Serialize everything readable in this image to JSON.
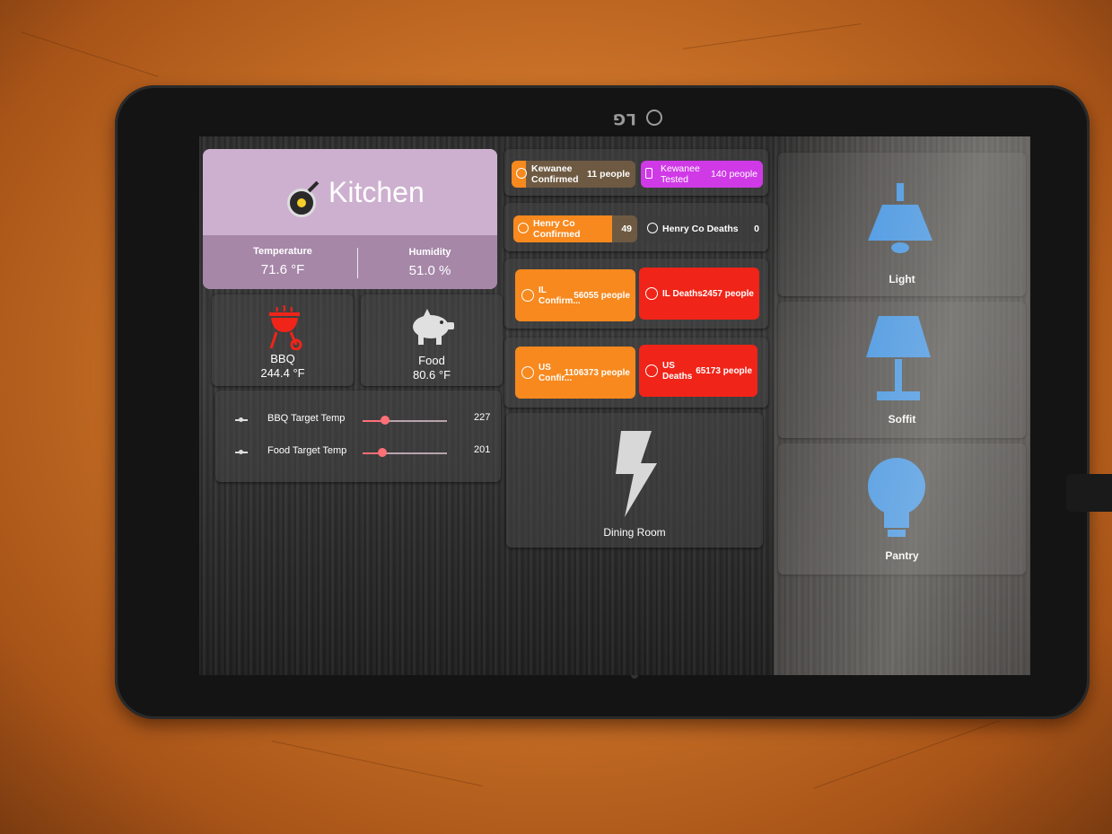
{
  "device": {
    "brand": "LG"
  },
  "kitchen": {
    "title": "Kitchen",
    "temperature_label": "Temperature",
    "temperature_value": "71.6 °F",
    "humidity_label": "Humidity",
    "humidity_value": "51.0 %"
  },
  "sensors": [
    {
      "name": "BBQ",
      "value": "244.4 °F",
      "icon": "grill-icon",
      "icon_color": "#f02418"
    },
    {
      "name": "Food",
      "value": "80.6 °F",
      "icon": "pig-icon",
      "icon_color": "#dddddd"
    }
  ],
  "sliders": [
    {
      "label": "BBQ Target Temp",
      "value": "227",
      "level": 0.27
    },
    {
      "label": "Food Target Temp",
      "value": "201",
      "level": 0.23
    }
  ],
  "stats": {
    "kewanee_confirmed": {
      "label_1": "Kewanee",
      "label_2": "Confirmed",
      "value": "11 people"
    },
    "kewanee_tested": {
      "label_1": "Kewanee",
      "label_2": "Tested",
      "value": "140 people"
    },
    "henry_confirmed": {
      "label_1": "Henry Co",
      "label_2": "Confirmed",
      "value": "49"
    },
    "henry_deaths": {
      "label": "Henry Co Deaths",
      "value": "0"
    },
    "il_confirmed": {
      "label_1": "IL",
      "label_2": "Confirm...",
      "value": "56055 people"
    },
    "il_deaths": {
      "label": "IL Deaths",
      "value": "2457 people"
    },
    "us_confirmed": {
      "label_1": "US",
      "label_2": "Confir...",
      "value": "1106373 people"
    },
    "us_deaths": {
      "label_1": "US",
      "label_2": "Deaths",
      "value": "65173 people"
    }
  },
  "dining_room": {
    "name": "Dining Room",
    "icon": "lightning-icon"
  },
  "lights": [
    {
      "name": "Light",
      "icon": "pendant-lamp-icon",
      "color": "#2f8de8"
    },
    {
      "name": "Soffit",
      "icon": "table-lamp-icon",
      "color": "#2f8de8"
    },
    {
      "name": "Pantry",
      "icon": "bulb-icon",
      "color": "#2f8de8"
    }
  ],
  "colors": {
    "orange": "#f7891e",
    "red": "#f02418",
    "purple": "#cf3ae6",
    "accent_blue": "#2f8de8"
  }
}
